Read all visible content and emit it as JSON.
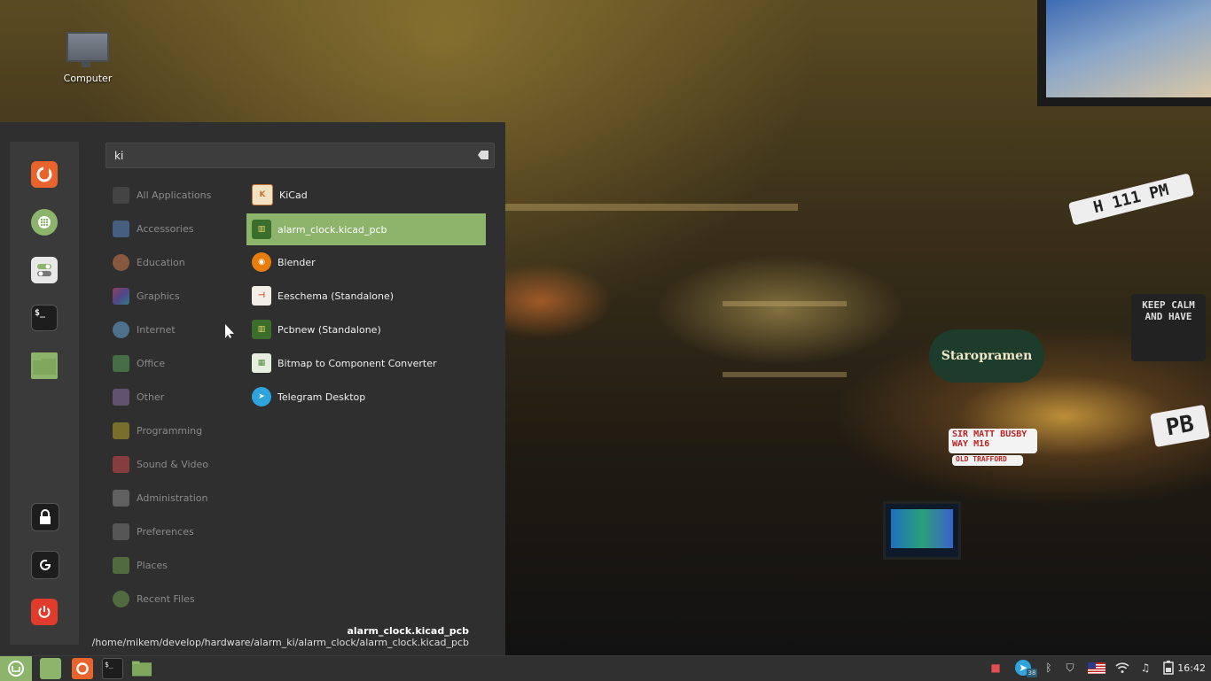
{
  "desktop": {
    "icons": [
      {
        "label": "Computer",
        "icon": "computer-icon"
      }
    ]
  },
  "wallpaper": {
    "signs": [
      "H 111 PM",
      "KEEP CALM AND HAVE",
      "Staropramen",
      "SIR MATT BUSBY WAY M16",
      "OLD TRAFFORD",
      "PB"
    ]
  },
  "menu": {
    "search": {
      "value": "ki"
    },
    "favorites": [
      {
        "name": "firefox",
        "icon": "firefox-icon",
        "color": "#e8642c"
      },
      {
        "name": "software-manager",
        "icon": "software-manager-icon",
        "color": "#8cb56b"
      },
      {
        "name": "settings",
        "icon": "toggle-settings-icon",
        "color": "#e0e0e0"
      },
      {
        "name": "terminal",
        "icon": "terminal-icon",
        "color": "#1d1d1d"
      },
      {
        "name": "files",
        "icon": "folder-icon",
        "color": "#8cb56b"
      }
    ],
    "session": [
      {
        "name": "lock",
        "icon": "lock-icon"
      },
      {
        "name": "logout",
        "icon": "logout-icon"
      },
      {
        "name": "shutdown",
        "icon": "power-icon",
        "color": "#e03b2b"
      }
    ],
    "categories": [
      {
        "label": "All Applications",
        "icon": "grid-icon",
        "color": "#555555"
      },
      {
        "label": "Accessories",
        "icon": "scissors-icon",
        "color": "#5a86c5"
      },
      {
        "label": "Education",
        "icon": "education-icon",
        "color": "#d07a4b"
      },
      {
        "label": "Graphics",
        "icon": "graphics-icon",
        "color": "#b259c9"
      },
      {
        "label": "Internet",
        "icon": "cloud-icon",
        "color": "#6aa6d6"
      },
      {
        "label": "Office",
        "icon": "office-icon",
        "color": "#5aa05a"
      },
      {
        "label": "Other",
        "icon": "other-icon",
        "color": "#8a6fa8"
      },
      {
        "label": "Programming",
        "icon": "programming-icon",
        "color": "#b8a22c"
      },
      {
        "label": "Sound & Video",
        "icon": "play-icon",
        "color": "#d04848"
      },
      {
        "label": "Administration",
        "icon": "admin-icon",
        "color": "#888888"
      },
      {
        "label": "Preferences",
        "icon": "preferences-icon",
        "color": "#777777"
      },
      {
        "label": "Places",
        "icon": "folder-icon",
        "color": "#6e9a4a"
      },
      {
        "label": "Recent Files",
        "icon": "recent-icon",
        "color": "#6e9a4a"
      }
    ],
    "apps": [
      {
        "label": "KiCad",
        "icon": "kicad-icon",
        "color": "#c8762e",
        "selected": false
      },
      {
        "label": "alarm_clock.kicad_pcb",
        "icon": "pcb-file-icon",
        "color": "#3b6e2d",
        "selected": true
      },
      {
        "label": "Blender",
        "icon": "blender-icon",
        "color": "#e87d0d",
        "selected": false
      },
      {
        "label": "Eeschema (Standalone)",
        "icon": "eeschema-icon",
        "color": "#d44a2a",
        "selected": false
      },
      {
        "label": "Pcbnew (Standalone)",
        "icon": "pcbnew-icon",
        "color": "#3b6e2d",
        "selected": false
      },
      {
        "label": "Bitmap to Component Converter",
        "icon": "bitmap-converter-icon",
        "color": "#4f8f3a",
        "selected": false
      },
      {
        "label": "Telegram Desktop",
        "icon": "telegram-icon",
        "color": "#2ea3dd",
        "selected": false
      }
    ],
    "info": {
      "name": "alarm_clock.kicad_pcb",
      "path": "/home/mikem/develop/hardware/alarm_ki/alarm_clock/alarm_clock.kicad_pcb"
    }
  },
  "taskbar": {
    "launchers": [
      {
        "name": "menu",
        "icon": "mint-menu-icon",
        "color": "#8cb56b"
      },
      {
        "name": "show-desktop",
        "icon": "show-desktop-icon",
        "color": "#8cb56b"
      },
      {
        "name": "firefox",
        "icon": "firefox-icon",
        "color": "#e8642c"
      },
      {
        "name": "terminal",
        "icon": "terminal-icon",
        "color": "#1d1d1d"
      },
      {
        "name": "files",
        "icon": "folder-icon",
        "color": "#8cb56b"
      }
    ],
    "tray": [
      {
        "name": "screen-recorder",
        "icon": "video-camera-icon",
        "color": "#e05050"
      },
      {
        "name": "telegram",
        "icon": "telegram-icon",
        "badge": "38"
      },
      {
        "name": "bluetooth",
        "icon": "bluetooth-icon"
      },
      {
        "name": "update-manager",
        "icon": "shield-icon"
      },
      {
        "name": "keyboard-layout",
        "icon": "us-flag-icon"
      },
      {
        "name": "network",
        "icon": "wifi-icon"
      },
      {
        "name": "sound",
        "icon": "music-note-icon"
      },
      {
        "name": "power",
        "icon": "battery-icon"
      }
    ],
    "clock": "16:42"
  }
}
